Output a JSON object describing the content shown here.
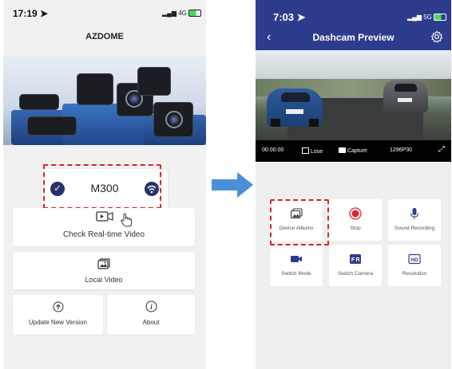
{
  "left_screen": {
    "status": {
      "time": "17:19",
      "network": "4G"
    },
    "app_title": "AZDOME",
    "device": {
      "name": "M300"
    },
    "buttons": {
      "live_video": "Check Real-time Video",
      "local_video": "Local Video",
      "update": "Update New Version",
      "about": "About"
    }
  },
  "right_screen": {
    "status": {
      "time": "7:03",
      "network": "5G"
    },
    "title": "Dashcam Preview",
    "video_bar": {
      "timestamp": "00:00:00",
      "lose": "Lose",
      "capture": "Capture",
      "resolution": "1296P30"
    },
    "tiles": [
      {
        "label": "Device Albums",
        "icon": "photo-album-icon"
      },
      {
        "label": "Stop",
        "icon": "stop-record-icon"
      },
      {
        "label": "Sound Recording",
        "icon": "microphone-icon"
      },
      {
        "label": "Switch Mode",
        "icon": "video-camera-icon"
      },
      {
        "label": "Switch Camera",
        "icon": "switch-camera-icon"
      },
      {
        "label": "Resolution",
        "icon": "hd-icon"
      }
    ]
  },
  "colors": {
    "accent": "#2e3c8e",
    "highlight": "#d9252b",
    "arrow": "#4a90d9"
  }
}
